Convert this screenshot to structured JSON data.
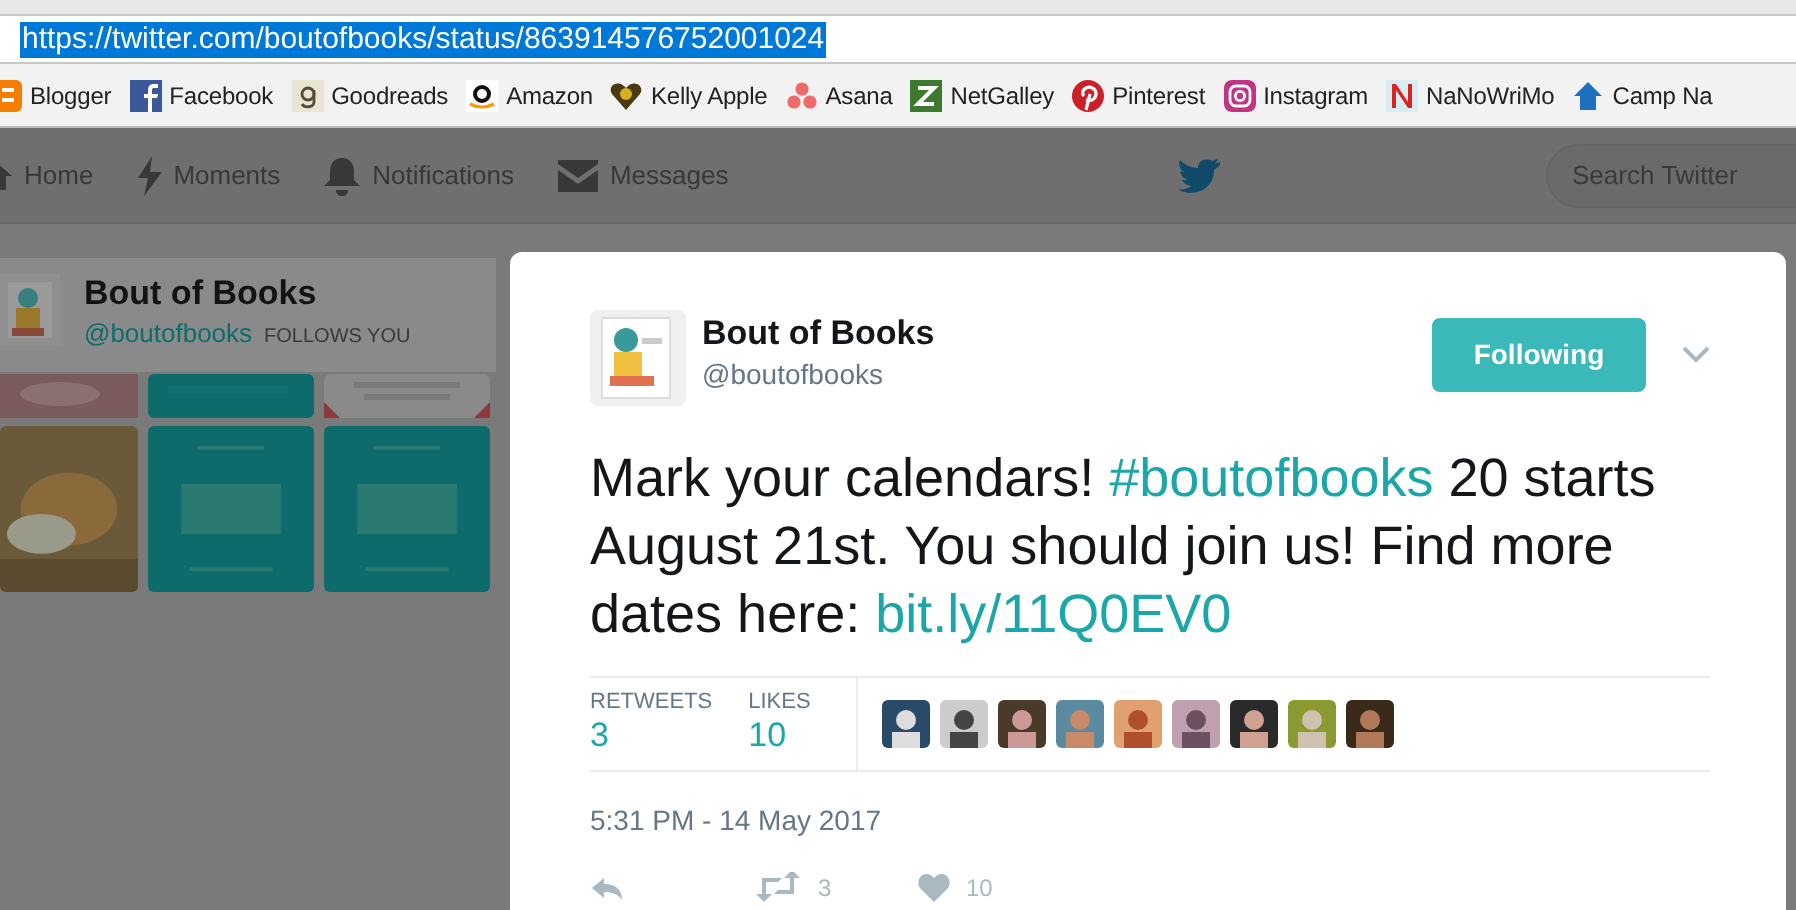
{
  "browser": {
    "url": "https://twitter.com/boutofbooks/status/863914576752001024",
    "url_selected": true,
    "bookmarks": [
      {
        "label": "Blogger"
      },
      {
        "label": "Facebook"
      },
      {
        "label": "Goodreads"
      },
      {
        "label": "Amazon"
      },
      {
        "label": "Kelly Apple"
      },
      {
        "label": "Asana"
      },
      {
        "label": "NetGalley"
      },
      {
        "label": "Pinterest"
      },
      {
        "label": "Instagram"
      },
      {
        "label": "NaNoWriMo"
      },
      {
        "label": "Camp Na"
      }
    ]
  },
  "nav": {
    "items": [
      {
        "label": "Home"
      },
      {
        "label": "Moments"
      },
      {
        "label": "Notifications"
      },
      {
        "label": "Messages"
      }
    ],
    "search": {
      "placeholder": "Search Twitter"
    }
  },
  "profile_card": {
    "name": "Bout of Books",
    "handle": "@boutofbooks",
    "badge": "FOLLOWS YOU"
  },
  "tweet": {
    "name": "Bout of Books",
    "handle": "@boutofbooks",
    "follow_button": "Following",
    "text": [
      {
        "kind": "plain",
        "text": "Mark your calendars! "
      },
      {
        "kind": "hashtag",
        "text": "#boutofbooks"
      },
      {
        "kind": "plain",
        "text": " 20 starts August 21st. You should join us! Find more dates here: "
      },
      {
        "kind": "link",
        "text": "bit.ly/11Q0EV0"
      }
    ],
    "stats": [
      {
        "label": "RETWEETS",
        "value": "3"
      },
      {
        "label": "LIKES",
        "value": "10"
      }
    ],
    "timestamp": "5:31 PM - 14 May 2017",
    "actions": [
      {
        "kind": "reply"
      },
      {
        "kind": "retweet",
        "count": "3"
      },
      {
        "kind": "like",
        "count": "10"
      }
    ]
  }
}
